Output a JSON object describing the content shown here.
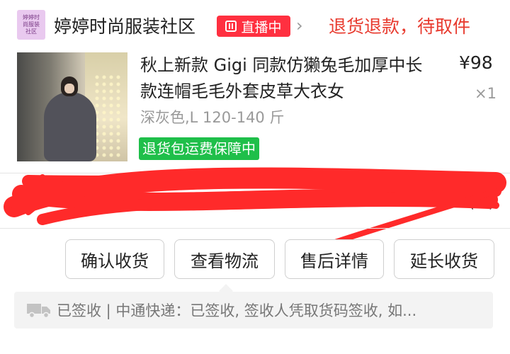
{
  "shop": {
    "logo_lines": [
      "婷婷时",
      "尚服装",
      "社区"
    ],
    "name": "婷婷时尚服装社区",
    "live_label": "直播中",
    "order_status": "退货退款，待取件"
  },
  "product": {
    "title": "秋上新款 Gigi 同款仿獭兔毛加厚中长款连帽毛毛外套皮草大衣女",
    "price": "¥98",
    "quantity": "×1",
    "sku": "深灰色,L 120-140 斤",
    "return_badge": "退货包运费保障中"
  },
  "address": {
    "visible_tail": "(址)"
  },
  "actions": {
    "confirm_receipt": "确认收货",
    "view_logistics": "查看物流",
    "after_sale_details": "售后详情",
    "extend_receipt": "延长收货"
  },
  "logistics": {
    "summary": "已签收 | 中通快递：已签收, 签收人凭取货码签收, 如..."
  },
  "colors": {
    "accent_red": "#e83b2f",
    "live_red": "#ff3040",
    "green_badge": "#1fbf4a"
  }
}
